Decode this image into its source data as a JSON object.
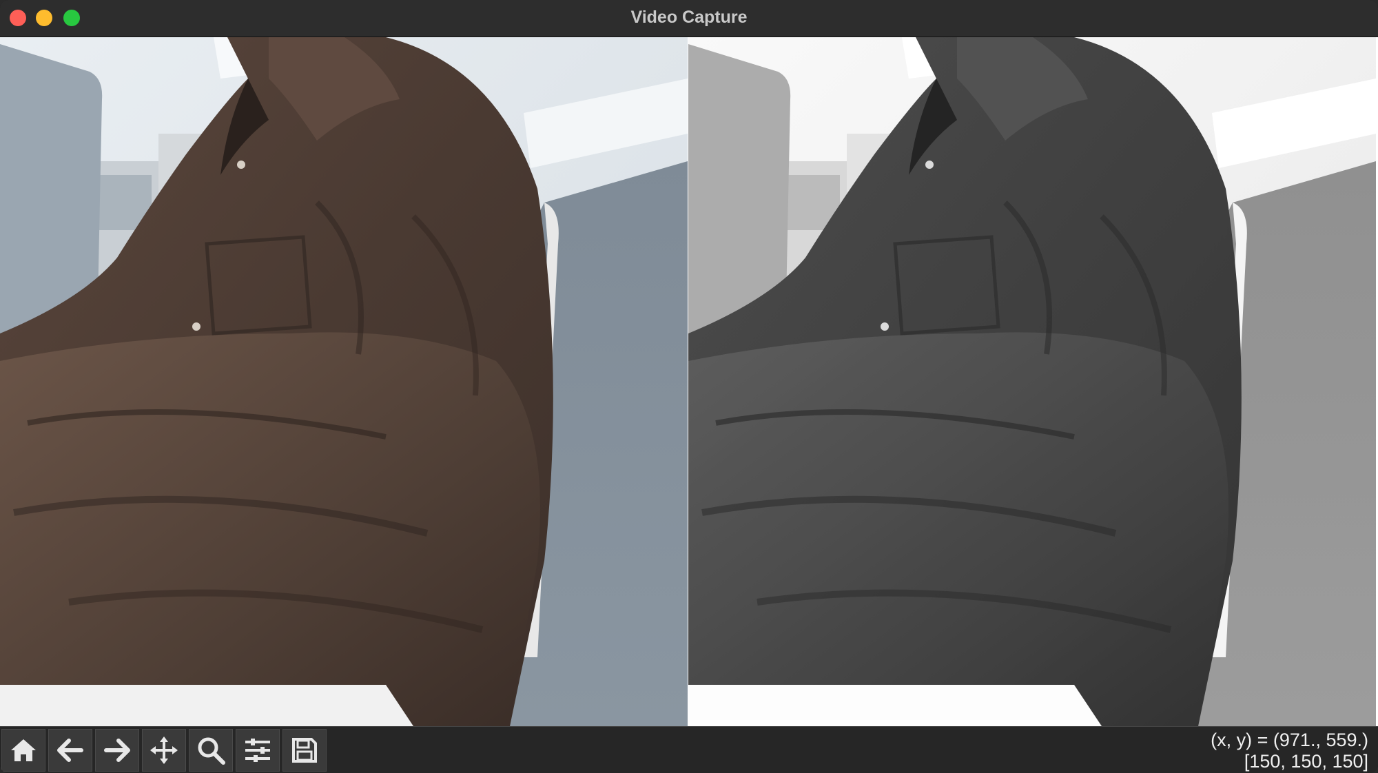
{
  "window": {
    "title": "Video Capture"
  },
  "frames": [
    {
      "mode": "color"
    },
    {
      "mode": "grayscale"
    }
  ],
  "toolbar": {
    "tools": [
      {
        "name": "home",
        "icon": "home-icon"
      },
      {
        "name": "back",
        "icon": "arrow-left-icon"
      },
      {
        "name": "forward",
        "icon": "arrow-right-icon"
      },
      {
        "name": "pan",
        "icon": "move-icon"
      },
      {
        "name": "zoom",
        "icon": "magnifier-icon"
      },
      {
        "name": "configure-subplots",
        "icon": "sliders-icon"
      },
      {
        "name": "save",
        "icon": "floppy-disk-icon"
      }
    ]
  },
  "status": {
    "coords_line": "(x, y) = (971., 559.)",
    "pixel_line": "[150, 150, 150]"
  },
  "colors": {
    "close": "#fe5f57",
    "minimize": "#febc2e",
    "maximize": "#28c840",
    "toolbar_bg": "#262626",
    "titlebar_bg": "#2d2d2d"
  }
}
